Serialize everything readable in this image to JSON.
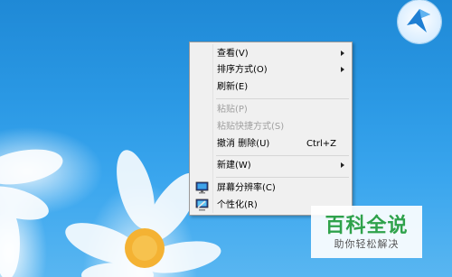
{
  "context_menu": {
    "items": [
      {
        "label": "查看(V)",
        "has_submenu": true,
        "disabled": false
      },
      {
        "label": "排序方式(O)",
        "has_submenu": true,
        "disabled": false
      },
      {
        "label": "刷新(E)",
        "has_submenu": false,
        "disabled": false
      },
      {
        "label": "粘贴(P)",
        "has_submenu": false,
        "disabled": true
      },
      {
        "label": "粘贴快捷方式(S)",
        "has_submenu": false,
        "disabled": true
      },
      {
        "label": "撤消 删除(U)",
        "shortcut": "Ctrl+Z",
        "has_submenu": false,
        "disabled": false
      },
      {
        "label": "新建(W)",
        "has_submenu": true,
        "disabled": false
      },
      {
        "label": "屏幕分辨率(C)",
        "icon": "monitor-icon",
        "has_submenu": false,
        "disabled": false
      },
      {
        "label": "个性化(R)",
        "icon": "personalize-icon",
        "has_submenu": false,
        "disabled": false
      }
    ]
  },
  "watermark": {
    "title": "百科全说",
    "subtitle": "助你轻松解决",
    "color": "#2fa24b"
  },
  "colors": {
    "menu_background": "#f0f0f0",
    "desktop_blue": "#2a98e4",
    "disabled_text": "#a0a0a0"
  }
}
